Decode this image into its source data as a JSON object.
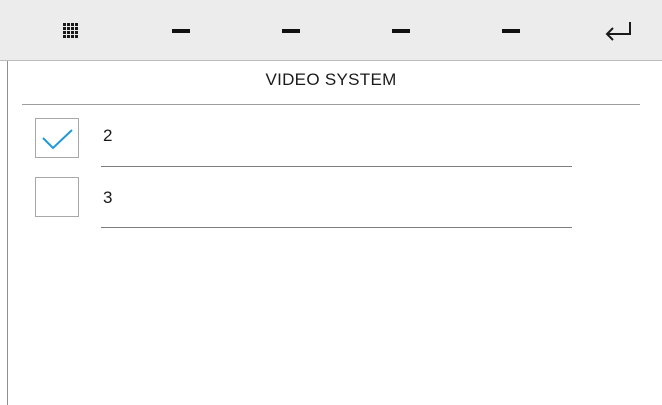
{
  "toolbar": {
    "buttons": [
      {
        "icon": "grid-menu-icon"
      },
      {
        "icon": "dash-icon"
      },
      {
        "icon": "dash-icon"
      },
      {
        "icon": "dash-icon"
      },
      {
        "icon": "dash-icon"
      },
      {
        "icon": "return-arrow-icon"
      }
    ]
  },
  "page": {
    "title": "VIDEO SYSTEM"
  },
  "options": [
    {
      "label": "2",
      "checked": true
    },
    {
      "label": "3",
      "checked": false
    }
  ],
  "colors": {
    "toolbar_bg": "#ececec",
    "checkmark": "#1f9ad6",
    "divider": "#9e9e9e"
  }
}
